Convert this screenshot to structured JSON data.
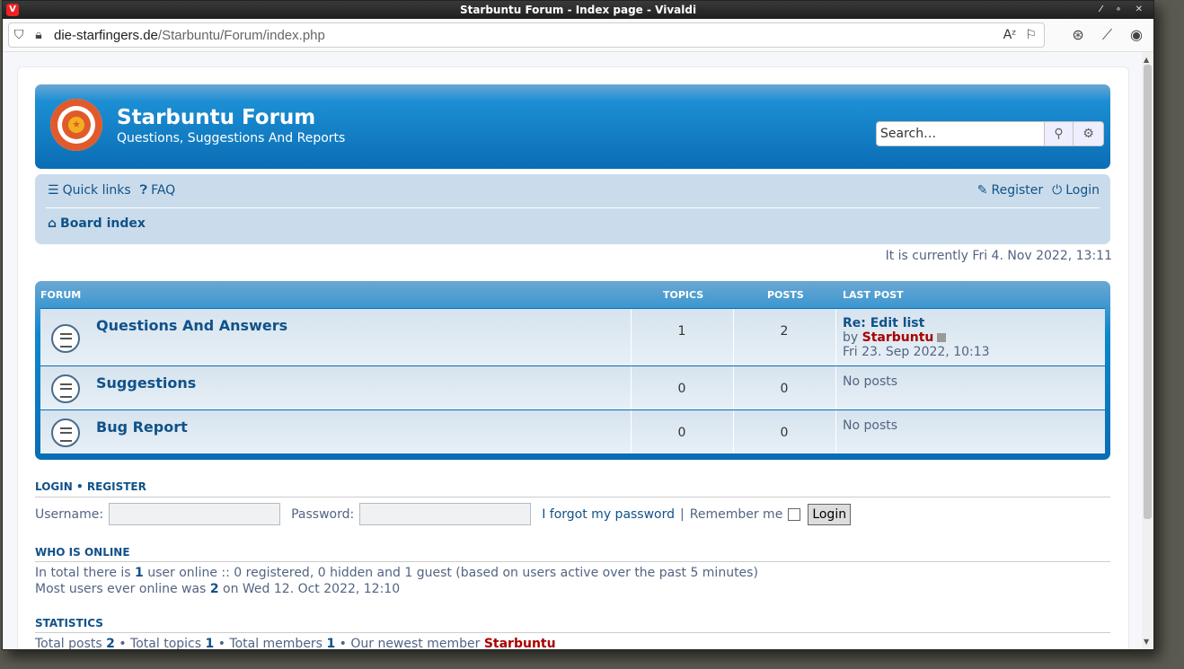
{
  "browser": {
    "window_title": "Starbuntu Forum - Index page - Vivaldi",
    "url_domain": "die-starfingers.de",
    "url_path": "/Starbuntu/Forum/index.php"
  },
  "site": {
    "title": "Starbuntu Forum",
    "description": "Questions, Suggestions And Reports",
    "search_placeholder": "Search…"
  },
  "nav": {
    "quick_links": "Quick links",
    "faq": "FAQ",
    "register": "Register",
    "login": "Login",
    "board_index": "Board index"
  },
  "current_time": "It is currently Fri 4. Nov 2022, 13:11",
  "forum_table": {
    "headers": {
      "forum": "FORUM",
      "topics": "TOPICS",
      "posts": "POSTS",
      "last_post": "LAST POST"
    },
    "rows": [
      {
        "title": "Questions And Answers",
        "topics": "1",
        "posts": "2",
        "last_post_title": "Re: Edit list",
        "last_post_by": "by",
        "last_post_user": "Starbuntu",
        "last_post_date": "Fri 23. Sep 2022, 10:13",
        "no_posts": ""
      },
      {
        "title": "Suggestions",
        "topics": "0",
        "posts": "0",
        "no_posts": "No posts"
      },
      {
        "title": "Bug Report",
        "topics": "0",
        "posts": "0",
        "no_posts": "No posts"
      }
    ]
  },
  "login_section": {
    "login_link": "LOGIN",
    "separator": "•",
    "register_link": "REGISTER",
    "username_label": "Username:",
    "password_label": "Password:",
    "forgot": "I forgot my password",
    "pipe": "|",
    "remember": "Remember me",
    "button": "Login"
  },
  "online": {
    "title": "WHO IS ONLINE",
    "line1_pre": "In total there is",
    "line1_count": "1",
    "line1_post": "user online :: 0 registered, 0 hidden and 1 guest (based on users active over the past 5 minutes)",
    "line2_pre": "Most users ever online was",
    "line2_count": "2",
    "line2_post": "on Wed 12. Oct 2022, 12:10"
  },
  "stats": {
    "title": "STATISTICS",
    "posts_label": "Total posts",
    "posts": "2",
    "topics_label": "• Total topics",
    "topics": "1",
    "members_label": "• Total members",
    "members": "1",
    "newest_label": "• Our newest member",
    "newest": "Starbuntu"
  }
}
